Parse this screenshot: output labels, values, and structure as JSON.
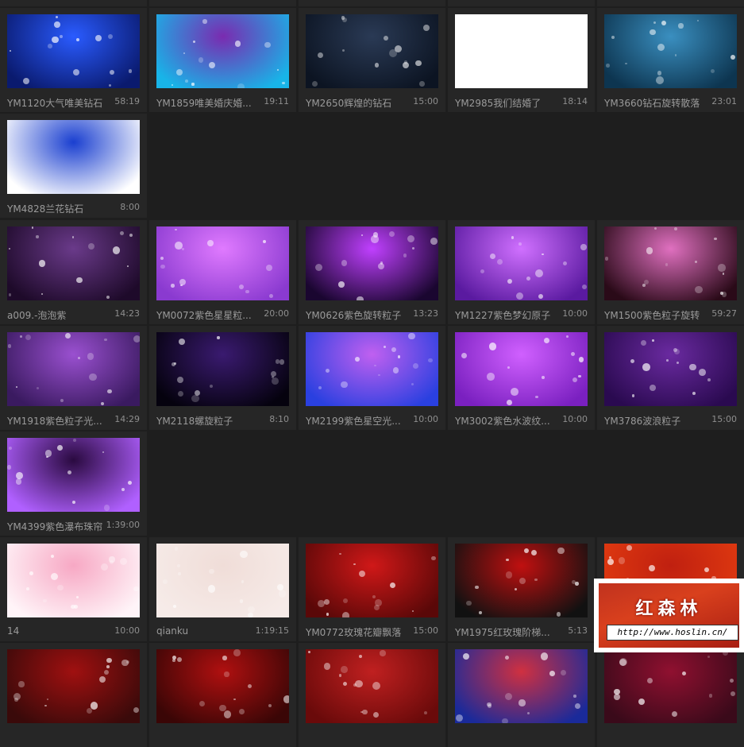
{
  "rows": [
    {
      "items": [
        {
          "label": "YM1120大气唯美钻石",
          "duration": "58:19",
          "colors": [
            "#0a1a6e",
            "#2a5bff"
          ]
        },
        {
          "label": "YM1859唯美婚庆婚...",
          "duration": "19:11",
          "colors": [
            "#18b4e8",
            "#7a2bb0"
          ]
        },
        {
          "label": "YM2650辉煌的钻石",
          "duration": "15:00",
          "colors": [
            "#0c1422",
            "#2a3a55"
          ]
        },
        {
          "label": "YM2985我们结婚了",
          "duration": "18:14",
          "colors": [
            "#ffffff",
            "#ffffff"
          ]
        },
        {
          "label": "YM3660钻石旋转散落",
          "duration": "23:01",
          "colors": [
            "#0d3550",
            "#3a8fc0"
          ]
        }
      ]
    },
    {
      "items": [
        {
          "label": "YM4828兰花钻石",
          "duration": "8:00",
          "colors": [
            "#ffffff",
            "#1a3fd0"
          ]
        }
      ]
    },
    {
      "items": [
        {
          "label": "a009.-泡泡紫",
          "duration": "14:23",
          "colors": [
            "#1e0a2a",
            "#6a3a8a"
          ]
        },
        {
          "label": "YM0072紫色星星粒...",
          "duration": "20:00",
          "colors": [
            "#8a3ad0",
            "#e07aff"
          ]
        },
        {
          "label": "YM0626紫色旋转粒子",
          "duration": "13:23",
          "colors": [
            "#1a0630",
            "#c040ff"
          ]
        },
        {
          "label": "YM1227紫色梦幻原子",
          "duration": "10:00",
          "colors": [
            "#5a1aa0",
            "#d070ff"
          ]
        },
        {
          "label": "YM1500紫色粒子旋转",
          "duration": "59:27",
          "colors": [
            "#2a0a18",
            "#e070c0"
          ]
        }
      ]
    },
    {
      "items": [
        {
          "label": "YM1918紫色粒子光...",
          "duration": "14:29",
          "colors": [
            "#3a1a60",
            "#9a50d0"
          ]
        },
        {
          "label": "YM2118螺旋粒子",
          "duration": "8:10",
          "colors": [
            "#05020e",
            "#3a1a70"
          ]
        },
        {
          "label": "YM2199紫色星空光...",
          "duration": "10:00",
          "colors": [
            "#2a40e0",
            "#c060f0"
          ]
        },
        {
          "label": "YM3002紫色水波纹...",
          "duration": "10:00",
          "colors": [
            "#7a20c0",
            "#d060ff"
          ]
        },
        {
          "label": "YM3786波浪粒子",
          "duration": "15:00",
          "colors": [
            "#2a0a50",
            "#6a2aa0"
          ]
        }
      ]
    },
    {
      "items": [
        {
          "label": "YM4399紫色瀑布珠帘",
          "duration": "1:39:00",
          "colors": [
            "#b060ff",
            "#2a0a40"
          ]
        }
      ]
    },
    {
      "items": [
        {
          "label": "14",
          "duration": "10:00",
          "colors": [
            "#fff4f8",
            "#f7a8c4"
          ]
        },
        {
          "label": "qianku",
          "duration": "1:19:15",
          "colors": [
            "#f6ebe8",
            "#f0ddd8"
          ]
        },
        {
          "label": "YM0772玫瑰花瓣飘落",
          "duration": "15:00",
          "colors": [
            "#5a0808",
            "#d01818"
          ]
        },
        {
          "label": "YM1975红玫瑰阶梯...",
          "duration": "5:13",
          "colors": [
            "#111111",
            "#c01010"
          ]
        },
        {
          "label": "",
          "duration": "",
          "colors": [
            "#e03a10",
            "#c02010"
          ]
        }
      ]
    },
    {
      "items": [
        {
          "label": "",
          "duration": "",
          "colors": [
            "#3a0a0a",
            "#a01010"
          ]
        },
        {
          "label": "",
          "duration": "",
          "colors": [
            "#3a0606",
            "#b01010"
          ]
        },
        {
          "label": "",
          "duration": "",
          "colors": [
            "#6a0a0a",
            "#c02020"
          ]
        },
        {
          "label": "",
          "duration": "",
          "colors": [
            "#1a2a9a",
            "#d03040"
          ]
        },
        {
          "label": "",
          "duration": "",
          "colors": [
            "#3a0a1a",
            "#901030"
          ]
        }
      ]
    }
  ],
  "watermark": {
    "title": "红森林",
    "url": "http://www.hoslin.cn/"
  }
}
